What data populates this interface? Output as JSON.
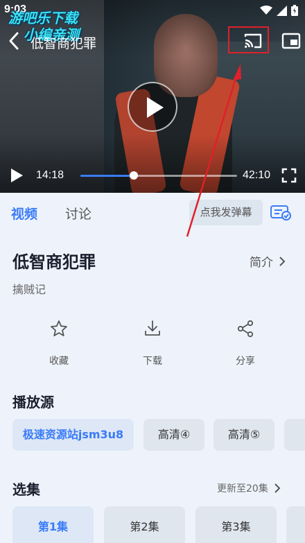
{
  "status": {
    "time": "9:03"
  },
  "watermark": {
    "line1": "游吧乐下载",
    "line2": "小编亲测"
  },
  "player": {
    "title": "低智商犯罪",
    "current_time": "14:18",
    "total_time": "42:10",
    "progress_fraction": 0.34
  },
  "tabs": {
    "active": "视频",
    "other": "讨论",
    "danmu_button": "点我发弹幕"
  },
  "info": {
    "title": "低智商犯罪",
    "intro_label": "简介",
    "subtitle": "擒贼记"
  },
  "actions": [
    {
      "label": "收藏",
      "icon": "star-icon"
    },
    {
      "label": "下载",
      "icon": "download-icon"
    },
    {
      "label": "分享",
      "icon": "share-icon"
    }
  ],
  "sources": {
    "title": "播放源",
    "items": [
      "极速资源站jsm3u8",
      "高清④",
      "高清⑤"
    ]
  },
  "episodes": {
    "title": "选集",
    "update_text": "更新至20集",
    "items": [
      "第1集",
      "第2集",
      "第3集"
    ]
  },
  "colors": {
    "accent": "#3a7cf7",
    "annotation": "#e0202a"
  }
}
